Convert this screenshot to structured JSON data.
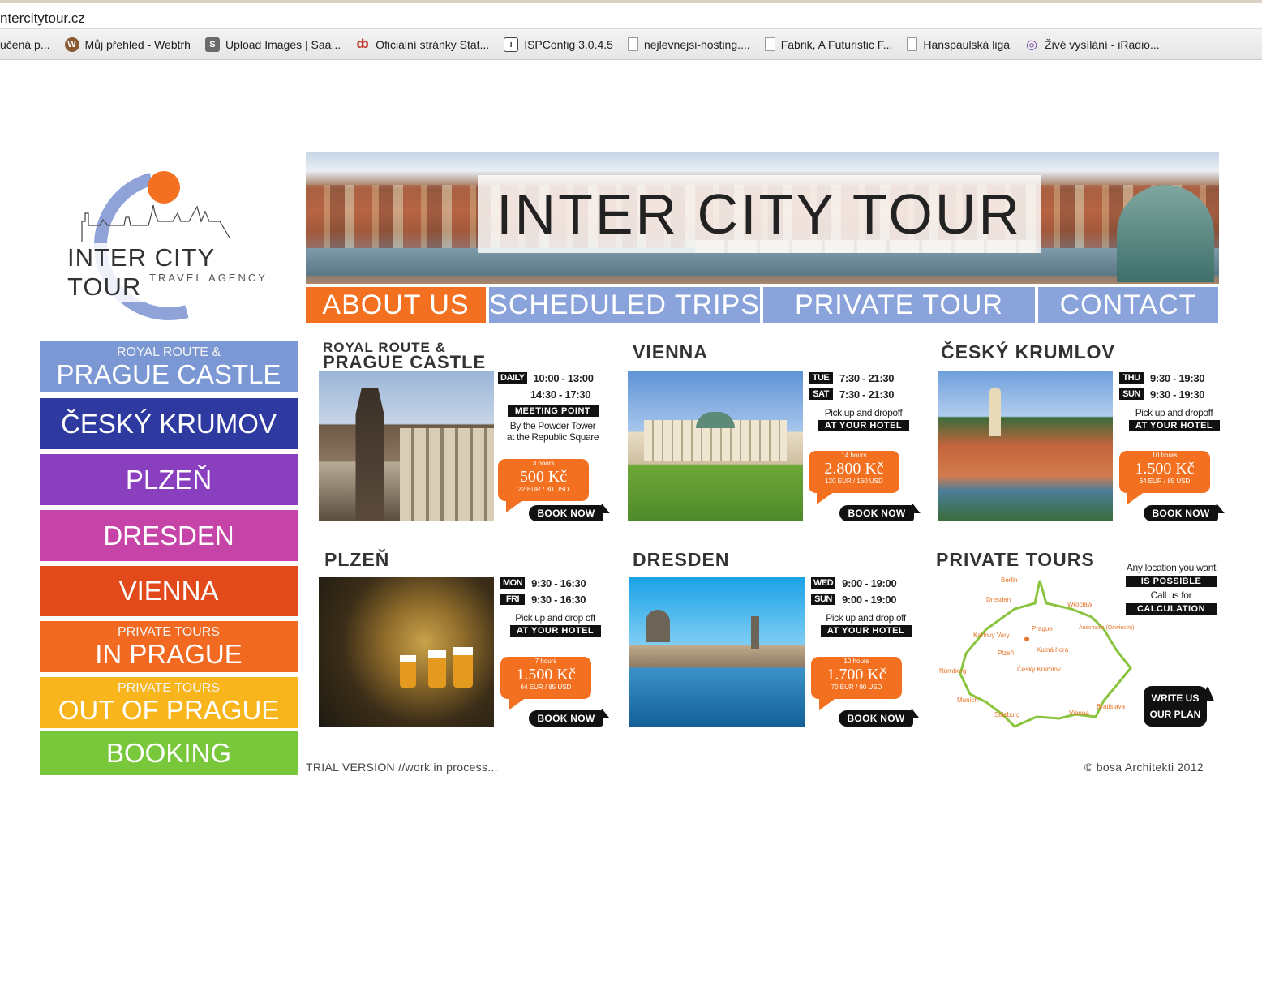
{
  "browser": {
    "url": "ntercitytour.cz",
    "bookmarks": [
      {
        "label": "učená p...",
        "icon": "none"
      },
      {
        "label": "Můj přehled - Webtrh",
        "icon": "webtrh-icon"
      },
      {
        "label": "Upload Images | Saa...",
        "icon": "saa-icon"
      },
      {
        "label": "Oficiální stránky Stat...",
        "icon": "stat-icon"
      },
      {
        "label": "ISPConfig 3.0.4.5",
        "icon": "ispconfig-icon"
      },
      {
        "label": "nejlevnejsi-hosting....",
        "icon": "page-icon"
      },
      {
        "label": "Fabrik, A Futuristic F...",
        "icon": "page-icon"
      },
      {
        "label": "Hanspaulská liga",
        "icon": "page-icon"
      },
      {
        "label": "Živé vysílání - iRadio...",
        "icon": "iradio-icon"
      }
    ]
  },
  "logo": {
    "name": "INTER CITY TOUR",
    "sub": "TRAVEL AGENCY"
  },
  "banner": {
    "title": "INTER CITY TOUR"
  },
  "nav": {
    "about": "ABOUT US",
    "scheduled": "SCHEDULED TRIPS",
    "private": "PRIVATE TOUR",
    "contact": "CONTACT"
  },
  "sidebar": {
    "items": [
      {
        "small": "ROYAL ROUTE &",
        "big": "PRAGUE CASTLE",
        "color": "#7b97d4"
      },
      {
        "small": "",
        "big": "ČESKÝ KRUMOV",
        "color": "#2e3aa0"
      },
      {
        "small": "",
        "big": "PLZEŇ",
        "color": "#8a3fbf"
      },
      {
        "small": "",
        "big": "DRESDEN",
        "color": "#c644a8"
      },
      {
        "small": "",
        "big": "VIENNA",
        "color": "#e24a1b"
      },
      {
        "small": "PRIVATE TOURS",
        "big": "IN PRAGUE",
        "color": "#f26a22"
      },
      {
        "small": "PRIVATE TOURS",
        "big": "OUT OF PRAGUE",
        "color": "#f8b51c"
      },
      {
        "small": "",
        "big": "BOOKING",
        "color": "#79c73a"
      }
    ]
  },
  "cards": {
    "prague": {
      "title_1": "ROYAL ROUTE &",
      "title_2": "PRAGUE CASTLE",
      "day_1": "DAILY",
      "time_1": "10:00 - 13:00",
      "time_2": "14:30 - 17:30",
      "meeting_label": "MEETING POINT",
      "meeting_1": "By the Powder Tower",
      "meeting_2": "at the Republic Square",
      "hours": "3 hours",
      "price": "500 Kč",
      "eur": "22 EUR / 30 USD",
      "book": "BOOK NOW"
    },
    "vienna": {
      "title": "VIENNA",
      "day_1": "TUE",
      "time_1": "7:30 - 21:30",
      "day_2": "SAT",
      "time_2": "7:30 - 21:30",
      "pickup": "Pick up and dropoff",
      "hotel": "AT YOUR HOTEL",
      "hours": "14 hours",
      "price": "2.800 Kč",
      "eur": "120 EUR / 160 USD",
      "book": "BOOK NOW"
    },
    "krumlov": {
      "title": "ČESKÝ KRUMLOV",
      "day_1": "THU",
      "time_1": "9:30 - 19:30",
      "day_2": "SUN",
      "time_2": "9:30 - 19:30",
      "pickup": "Pick up and dropoff",
      "hotel": "AT YOUR HOTEL",
      "hours": "10 hours",
      "price": "1.500 Kč",
      "eur": "64 EUR / 85 USD",
      "book": "BOOK NOW"
    },
    "plzen": {
      "title": "PLZEŇ",
      "day_1": "MON",
      "time_1": "9:30 - 16:30",
      "day_2": "FRI",
      "time_2": "9:30 - 16:30",
      "pickup": "Pick up and drop off",
      "hotel": "AT YOUR HOTEL",
      "hours": "7 hours",
      "price": "1.500 Kč",
      "eur": "64 EUR / 85 USD",
      "book": "BOOK NOW"
    },
    "dresden": {
      "title": "DRESDEN",
      "day_1": "WED",
      "time_1": "9:00 - 19:00",
      "day_2": "SUN",
      "time_2": "9:00 - 19:00",
      "pickup": "Pick up and drop off",
      "hotel": "AT YOUR HOTEL",
      "hours": "10 hours",
      "price": "1.700 Kč",
      "eur": "70 EUR / 90 USD",
      "book": "BOOK NOW"
    },
    "private": {
      "title": "PRIVATE TOURS",
      "line_1": "Any location you want",
      "bar_1": "IS POSSIBLE",
      "line_2": "Call us for",
      "bar_2": "CALCULATION",
      "write_1": "WRITE US",
      "write_2": "OUR PLAN",
      "cities": [
        "Berlin",
        "Dresden",
        "Wrocław",
        "Prague",
        "Karlovy Vary",
        "Plzeň",
        "Kutná hora",
        "Český Krumlov",
        "Nürnberg",
        "Munich",
        "Salzburg",
        "Vienna",
        "Bratislava",
        "Auschwitz (Oświęcim)"
      ]
    }
  },
  "footer": {
    "left": "TRIAL VERSION //work in process...",
    "right": "© bosa Architekti 2012"
  }
}
